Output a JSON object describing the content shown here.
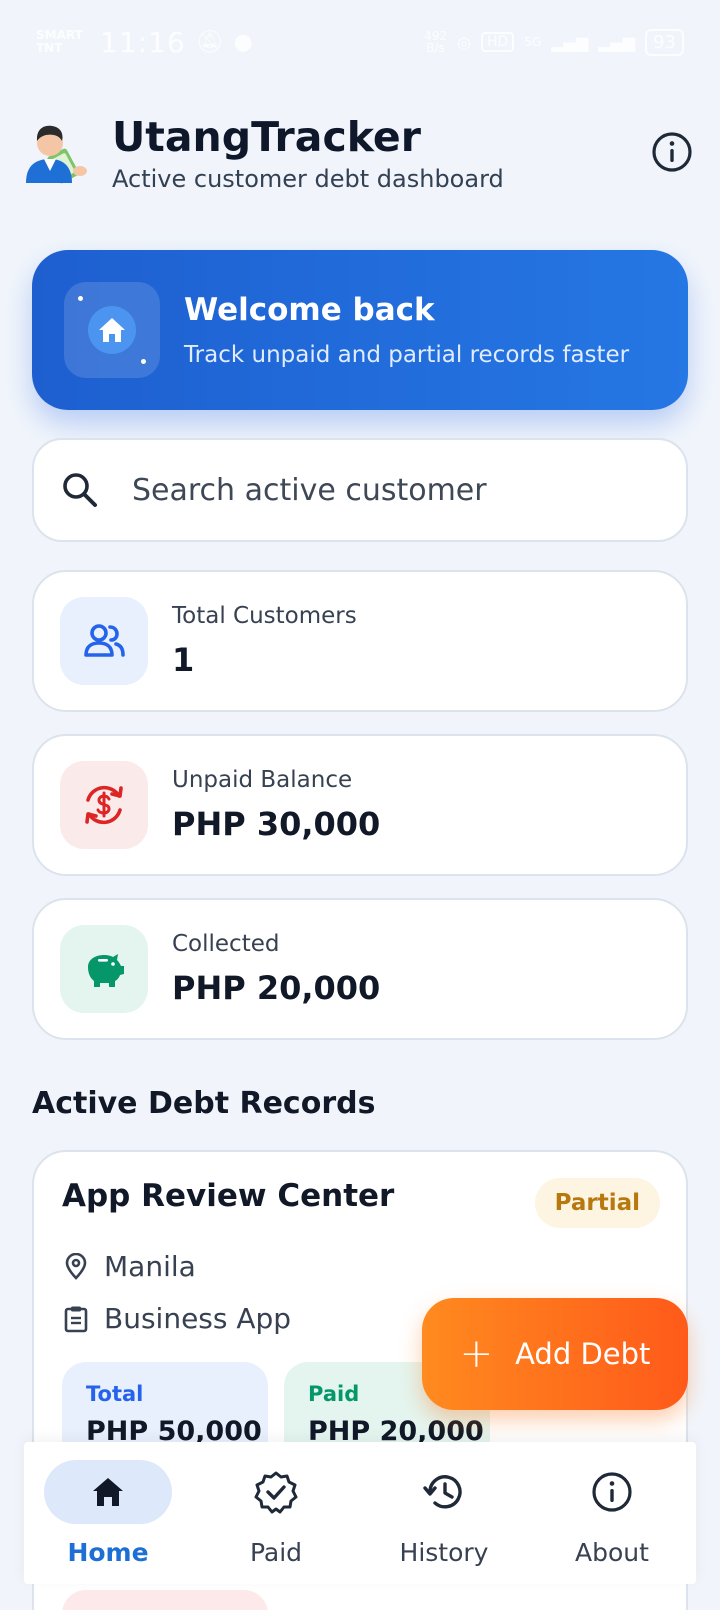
{
  "status_bar": {
    "carrier_line1": "SMART",
    "carrier_line2": "TNT",
    "time": "11:16",
    "network_speed_value": "492",
    "network_speed_unit": "B/s",
    "hd_label": "HD",
    "signal_label": "5G",
    "battery": "93"
  },
  "header": {
    "title": "UtangTracker",
    "subtitle": "Active customer debt dashboard"
  },
  "welcome": {
    "title": "Welcome back",
    "subtitle": "Track unpaid and partial records faster"
  },
  "search": {
    "placeholder": "Search active customer"
  },
  "stats": {
    "customers": {
      "label": "Total Customers",
      "value": "1",
      "color": "#2563eb"
    },
    "unpaid": {
      "label": "Unpaid Balance",
      "value": "PHP 30,000",
      "color": "#dc2626"
    },
    "collected": {
      "label": "Collected",
      "value": "PHP 20,000",
      "color": "#059669"
    }
  },
  "section": {
    "title": "Active Debt Records"
  },
  "record": {
    "name": "App Review Center",
    "status": "Partial",
    "location": "Manila",
    "category": "Business App",
    "total_label": "Total",
    "total_value": "PHP 50,000",
    "paid_label": "Paid",
    "paid_value": "PHP 20,000"
  },
  "fab": {
    "label": "Add Debt"
  },
  "nav": {
    "items": [
      {
        "label": "Home",
        "icon": "home-icon",
        "active": true
      },
      {
        "label": "Paid",
        "icon": "verified-badge-icon",
        "active": false
      },
      {
        "label": "History",
        "icon": "history-icon",
        "active": false
      },
      {
        "label": "About",
        "icon": "info-icon",
        "active": false
      }
    ]
  },
  "colors": {
    "primary": "#1d6fd6",
    "accent_orange": "#ff6f1c",
    "background": "#f1f5fb"
  }
}
